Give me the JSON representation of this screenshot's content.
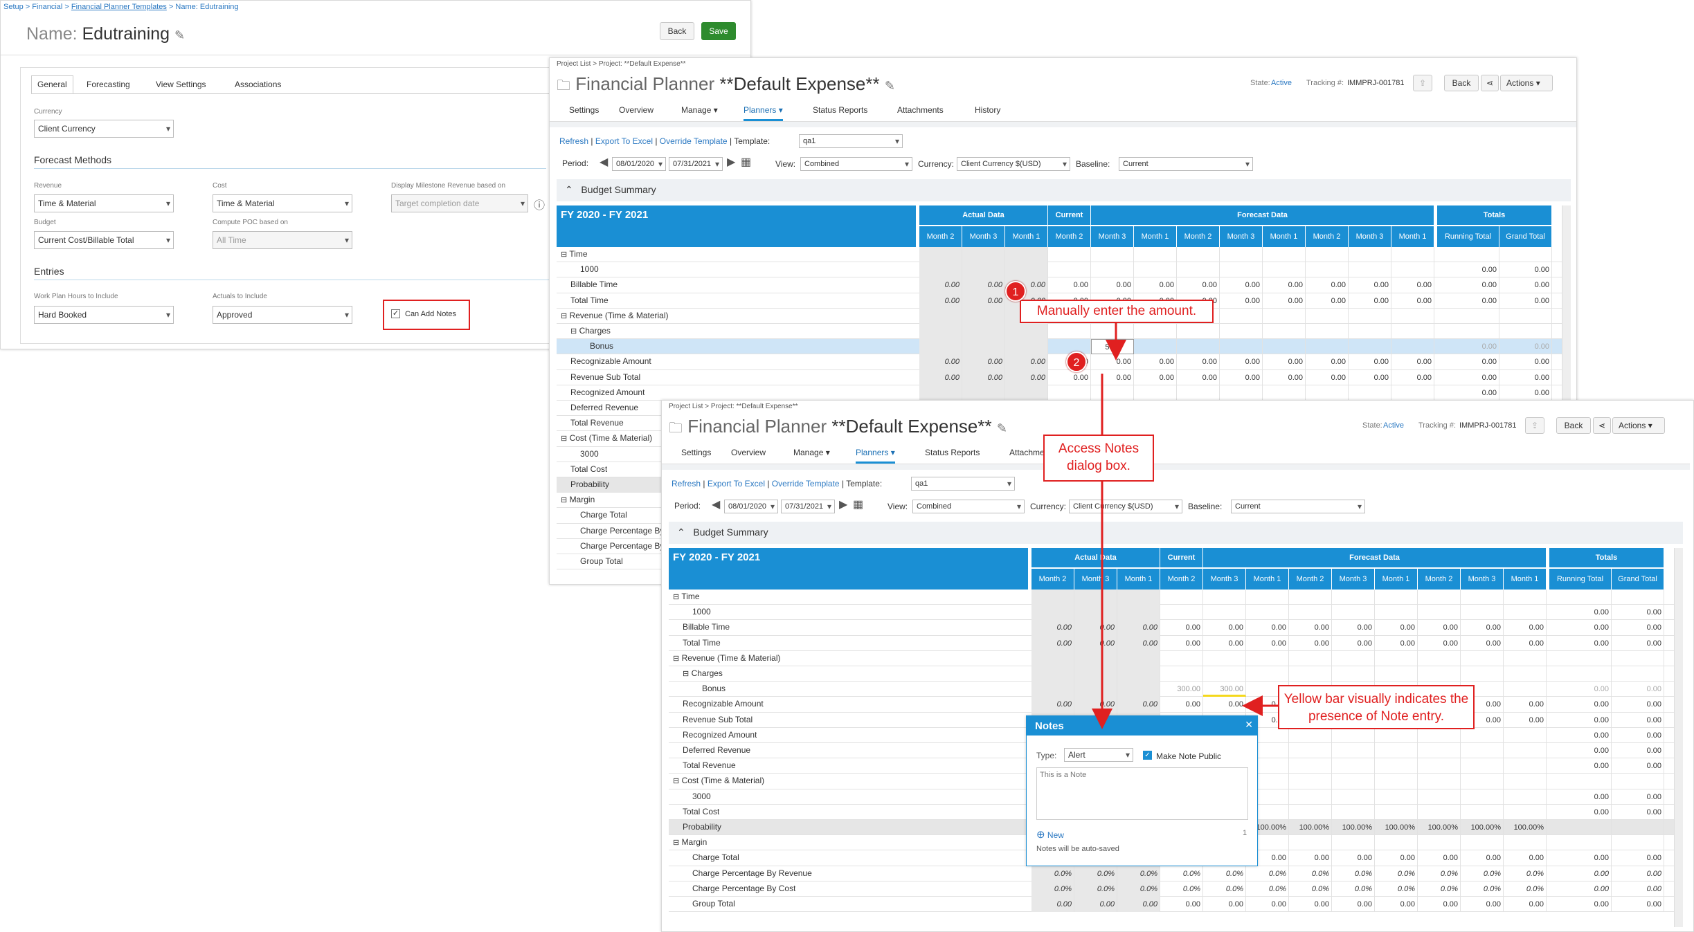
{
  "setup": {
    "breadcrumb": [
      "Setup",
      "Financial",
      "Financial Planner Templates",
      "Name: Edutraining"
    ],
    "title_label": "Name:",
    "title_value": "Edutraining",
    "back": "Back",
    "save": "Save",
    "tabs": [
      "General",
      "Forecasting",
      "View Settings",
      "Associations"
    ],
    "currency_label": "Currency",
    "currency_value": "Client Currency",
    "forecast_methods": "Forecast Methods",
    "revenue_label": "Revenue",
    "revenue_value": "Time & Material",
    "cost_label": "Cost",
    "cost_value": "Time & Material",
    "display_ms_label": "Display Milestone Revenue based on",
    "display_ms_value": "Target completion date",
    "budget_label": "Budget",
    "budget_value": "Current Cost/Billable Total",
    "poc_label": "Compute POC based on",
    "poc_value": "All Time",
    "entries": "Entries",
    "wph_label": "Work Plan Hours to Include",
    "wph_value": "Hard Booked",
    "actuals_label": "Actuals to Include",
    "actuals_value": "Approved",
    "can_add_notes": "Can Add Notes"
  },
  "planner": {
    "breadcrumb": "Project List > Project: **Default Expense**",
    "title_label": "Financial Planner",
    "title_value": "**Default Expense**",
    "state_label": "State:",
    "state_value": "Active",
    "tracking_label": "Tracking #:",
    "tracking_value": "IMMPRJ-001781",
    "back": "Back",
    "actions": "Actions",
    "tabs": [
      "Settings",
      "Overview",
      "Manage",
      "Planners",
      "Status Reports",
      "Attachments",
      "History"
    ],
    "links": [
      "Refresh",
      "Export To Excel",
      "Override Template"
    ],
    "template_label": "Template:",
    "template_value": "qa1",
    "period_label": "Period:",
    "period_from": "08/01/2020",
    "period_to": "07/31/2021",
    "view_label": "View:",
    "view_value": "Combined",
    "currency_label": "Currency:",
    "currency_value": "Client Currency $(USD)",
    "baseline_label": "Baseline:",
    "baseline_value": "Current",
    "budget_summary": "Budget Summary",
    "fy": "FY 2020 - FY 2021",
    "groups": [
      "Actual Data",
      "Current",
      "Forecast Data",
      "Totals"
    ],
    "cols": [
      "Month 2",
      "Month 3",
      "Month 1",
      "Month 2",
      "Month 3",
      "Month 1",
      "Month 2",
      "Month 3",
      "Month 1",
      "Month 2",
      "Month 3",
      "Month 1",
      "Running Total",
      "Grand Total"
    ],
    "rows": [
      "Time",
      "1000",
      "Billable Time",
      "Total Time",
      "Revenue (Time & Material)",
      "Charges",
      "Bonus",
      "Recognizable Amount",
      "Revenue Sub Total",
      "Recognized Amount",
      "Deferred Revenue",
      "Total Revenue",
      "Cost (Time & Material)",
      "3000",
      "Total Cost",
      "Probability",
      "Margin",
      "Charge Total",
      "Charge Percentage By Revenue",
      "Charge Percentage By Cost",
      "Group Total"
    ],
    "zero": "0.00",
    "zero_pct": "0.0%",
    "hundred_pct": "100.00%",
    "bonus_entry": "500",
    "bonus_value": "300.00"
  },
  "notes": {
    "title": "Notes",
    "type_label": "Type:",
    "type_value": "Alert",
    "public_label": "Make Note Public",
    "placeholder": "This is a Note",
    "new": "New",
    "count": "1",
    "autosave": "Notes will be auto-saved"
  },
  "callouts": {
    "c1": "Manually enter the amount.",
    "c2": "Access Notes dialog box.",
    "c3": "Yellow bar visually indicates the presence of Note entry.",
    "n1": "1",
    "n2": "2"
  }
}
